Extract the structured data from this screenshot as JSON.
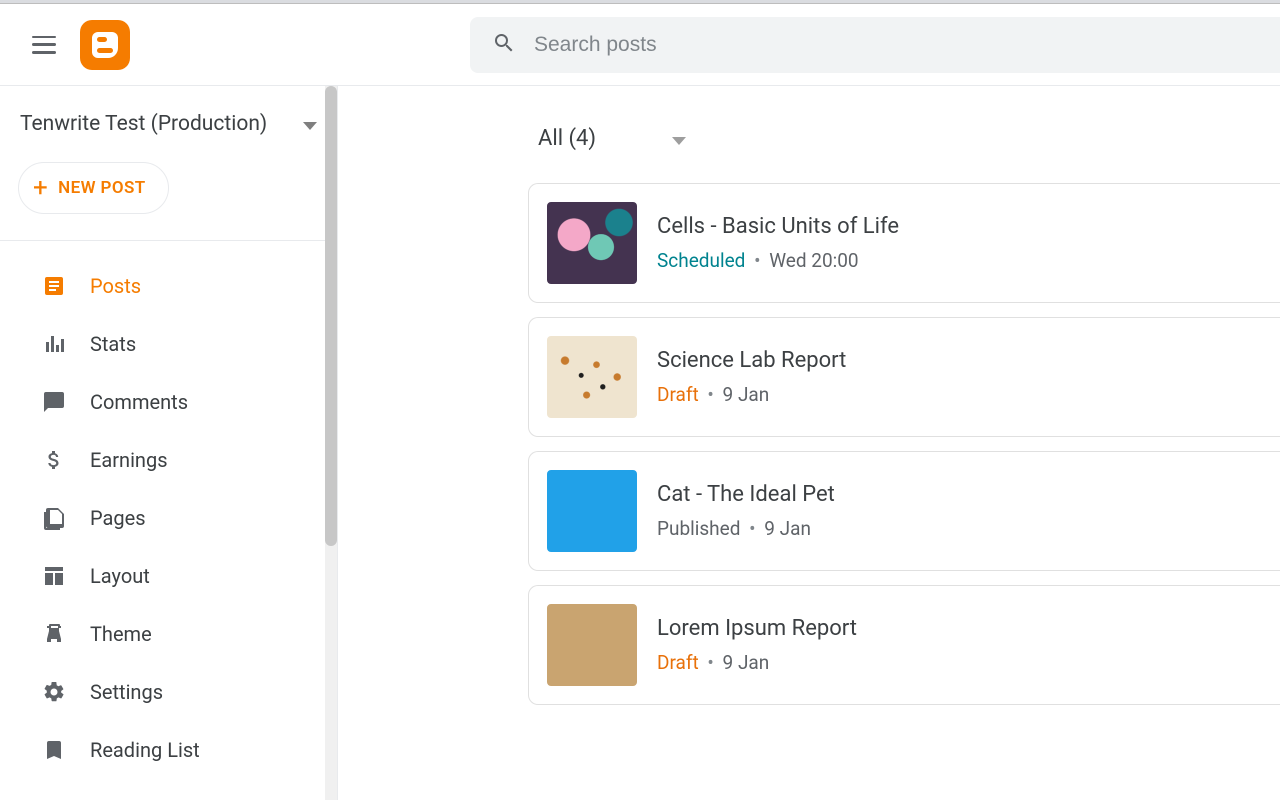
{
  "header": {
    "search_placeholder": "Search posts"
  },
  "sidebar": {
    "blog_name": "Tenwrite Test (Production)",
    "new_post_label": "NEW POST",
    "items": [
      {
        "label": "Posts",
        "icon": "posts-icon",
        "active": true
      },
      {
        "label": "Stats",
        "icon": "stats-icon",
        "active": false
      },
      {
        "label": "Comments",
        "icon": "comments-icon",
        "active": false
      },
      {
        "label": "Earnings",
        "icon": "earnings-icon",
        "active": false
      },
      {
        "label": "Pages",
        "icon": "pages-icon",
        "active": false
      },
      {
        "label": "Layout",
        "icon": "layout-icon",
        "active": false
      },
      {
        "label": "Theme",
        "icon": "theme-icon",
        "active": false
      },
      {
        "label": "Settings",
        "icon": "settings-icon",
        "active": false
      },
      {
        "label": "Reading List",
        "icon": "readinglist-icon",
        "active": false
      }
    ]
  },
  "main": {
    "filter_label": "All (4)",
    "posts": [
      {
        "title": "Cells - Basic Units of Life",
        "status": "Scheduled",
        "status_class": "scheduled",
        "date": "Wed 20:00",
        "thumb": "cells"
      },
      {
        "title": "Science Lab Report",
        "status": "Draft",
        "status_class": "draft",
        "date": "9 Jan",
        "thumb": "science"
      },
      {
        "title": "Cat - The Ideal Pet",
        "status": "Published",
        "status_class": "published",
        "date": "9 Jan",
        "thumb": "blue"
      },
      {
        "title": "Lorem Ipsum Report",
        "status": "Draft",
        "status_class": "draft",
        "date": "9 Jan",
        "thumb": "tan"
      }
    ]
  }
}
